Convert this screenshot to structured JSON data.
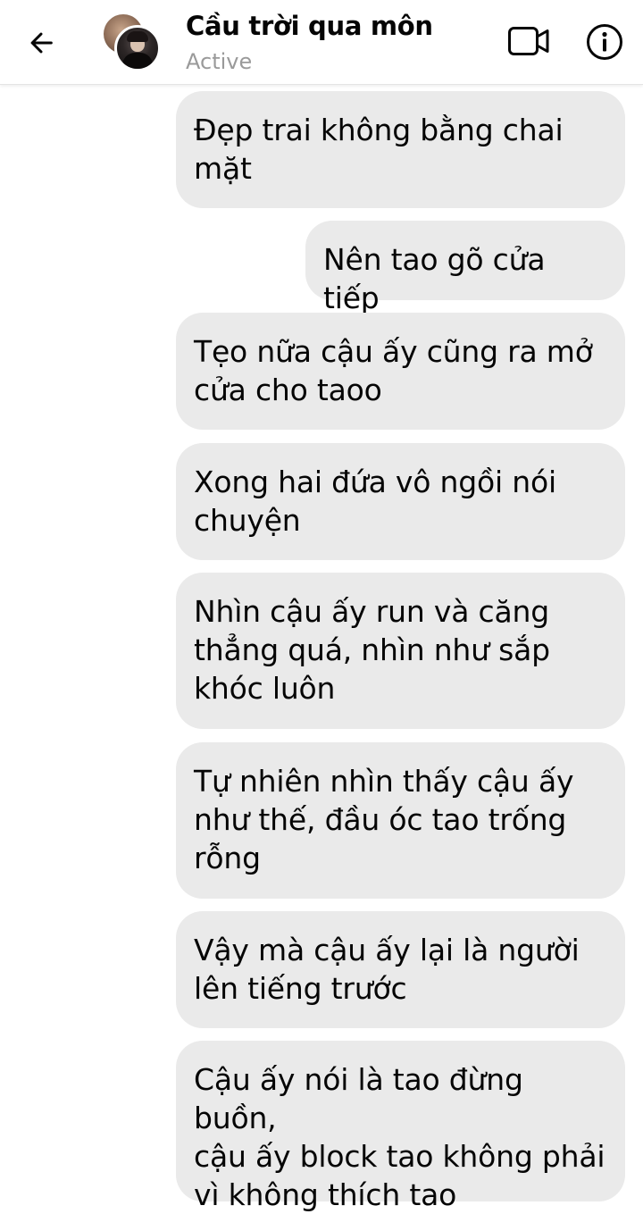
{
  "header": {
    "contact_name": "Cầu trời qua môn",
    "status": "Active"
  },
  "icons": {
    "back": "back-arrow-icon",
    "avatar": "avatar",
    "video": "video-call-icon",
    "info": "info-icon"
  },
  "colors": {
    "bubble_background": "#eaeaea",
    "status_text": "#9a9a9a",
    "text": "#050505"
  },
  "messages": [
    {
      "text": "Đẹp trai không bằng chai\nmặt"
    },
    {
      "text": "Nên tao gõ cửa tiếp"
    },
    {
      "text": "Tẹo nữa cậu ấy cũng ra mở\ncửa cho taoo"
    },
    {
      "text": "Xong hai đứa vô ngồi nói\nchuyện"
    },
    {
      "text": "Nhìn cậu ấy run và căng\nthẳng quá, nhìn như sắp\nkhóc luôn"
    },
    {
      "text": "Tự nhiên nhìn thấy cậu ấy\nnhư thế, đầu óc tao trống\nrỗng"
    },
    {
      "text": "Vậy mà cậu ấy lại là người\nlên tiếng trước"
    },
    {
      "text": "Cậu ấy nói là tao đừng buồn,\ncậu ấy block tao không phải\nvì không thích tao"
    }
  ]
}
